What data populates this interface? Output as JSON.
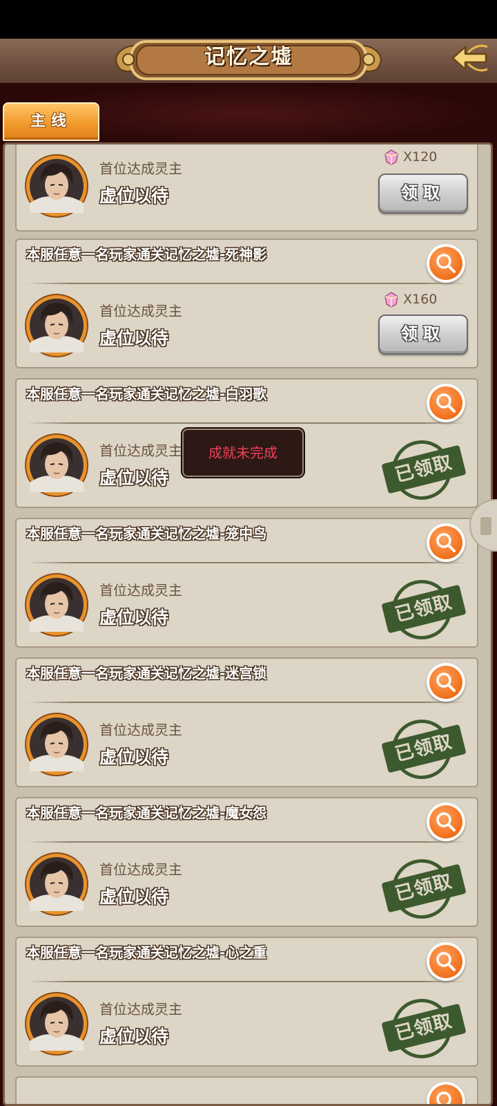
{
  "header": {
    "title": "记忆之墟",
    "back_icon": "back-arrow-icon"
  },
  "tabs": [
    {
      "label": "主线",
      "active": true
    }
  ],
  "cards": [
    {
      "title": "",
      "subtitle": "首位达成灵主",
      "holder": "虚位以待",
      "reward": "X120",
      "status": "claim",
      "button_label": "领取"
    },
    {
      "title": "本服任意一名玩家通关记忆之墟-死神影",
      "subtitle": "首位达成灵主",
      "holder": "虚位以待",
      "reward": "X160",
      "status": "claim",
      "button_label": "领取"
    },
    {
      "title": "本服任意一名玩家通关记忆之墟-白羽歌",
      "subtitle": "首位达成灵主",
      "holder": "虚位以待",
      "status": "claimed",
      "stamp_label": "已领取"
    },
    {
      "title": "本服任意一名玩家通关记忆之墟-笼中鸟",
      "subtitle": "首位达成灵主",
      "holder": "虚位以待",
      "status": "claimed",
      "stamp_label": "已领取"
    },
    {
      "title": "本服任意一名玩家通关记忆之墟-迷宫锁",
      "subtitle": "首位达成灵主",
      "holder": "虚位以待",
      "status": "claimed",
      "stamp_label": "已领取"
    },
    {
      "title": "本服任意一名玩家通关记忆之墟-魔女怨",
      "subtitle": "首位达成灵主",
      "holder": "虚位以待",
      "status": "claimed",
      "stamp_label": "已领取"
    },
    {
      "title": "本服任意一名玩家通关记忆之墟-心之重",
      "subtitle": "首位达成灵主",
      "holder": "虚位以待",
      "status": "claimed",
      "stamp_label": "已领取"
    }
  ],
  "toast": {
    "message": "成就未完成"
  },
  "colors": {
    "accent_orange": "#f0701a",
    "stamp_green": "#3d5a2e",
    "toast_text": "#f0405a",
    "card_bg": "#ddd5c6"
  }
}
